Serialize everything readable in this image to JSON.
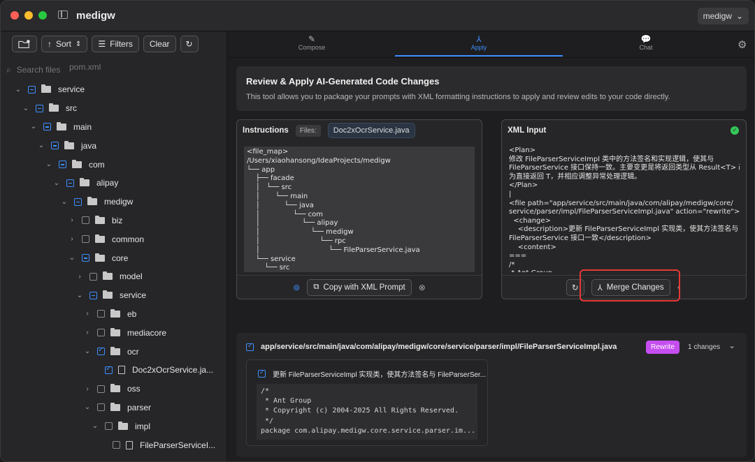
{
  "window": {
    "title": "medigw",
    "project_selector": "medigw"
  },
  "sidebar": {
    "toolbar": {
      "sort_label": "Sort",
      "filters_label": "Filters",
      "clear_label": "Clear"
    },
    "search_placeholder": "Search files",
    "ghost_text": "pom.xml",
    "tree": [
      {
        "label": "service",
        "depth": 1,
        "kind": "folder",
        "check": "ind",
        "open": true
      },
      {
        "label": "src",
        "depth": 2,
        "kind": "folder",
        "check": "ind",
        "open": true
      },
      {
        "label": "main",
        "depth": 3,
        "kind": "folder",
        "check": "ind",
        "open": true
      },
      {
        "label": "java",
        "depth": 4,
        "kind": "folder",
        "check": "ind",
        "open": true
      },
      {
        "label": "com",
        "depth": 5,
        "kind": "folder",
        "check": "ind",
        "open": true
      },
      {
        "label": "alipay",
        "depth": 6,
        "kind": "folder",
        "check": "ind",
        "open": true
      },
      {
        "label": "medigw",
        "depth": 7,
        "kind": "folder",
        "check": "ind",
        "open": true
      },
      {
        "label": "biz",
        "depth": 8,
        "kind": "folder",
        "check": "none",
        "open": false
      },
      {
        "label": "common",
        "depth": 8,
        "kind": "folder",
        "check": "none",
        "open": false
      },
      {
        "label": "core",
        "depth": 8,
        "kind": "folder",
        "check": "ind",
        "open": true
      },
      {
        "label": "model",
        "depth": 9,
        "kind": "folder",
        "check": "none",
        "open": false
      },
      {
        "label": "service",
        "depth": 9,
        "kind": "folder",
        "check": "ind",
        "open": true
      },
      {
        "label": "eb",
        "depth": 10,
        "kind": "folder",
        "check": "none",
        "open": false
      },
      {
        "label": "mediacore",
        "depth": 10,
        "kind": "folder",
        "check": "none",
        "open": false
      },
      {
        "label": "ocr",
        "depth": 10,
        "kind": "folder",
        "check": "chk",
        "open": true
      },
      {
        "label": "Doc2xOcrService.ja...",
        "depth": 11,
        "kind": "file",
        "check": "chk",
        "open": null
      },
      {
        "label": "oss",
        "depth": 10,
        "kind": "folder",
        "check": "none",
        "open": false
      },
      {
        "label": "parser",
        "depth": 10,
        "kind": "folder",
        "check": "none",
        "open": true
      },
      {
        "label": "impl",
        "depth": 11,
        "kind": "folder",
        "check": "none",
        "open": true
      },
      {
        "label": "FileParserServiceI...",
        "depth": 12,
        "kind": "file",
        "check": "none",
        "open": null
      }
    ]
  },
  "tabs": [
    {
      "label": "Compose",
      "icon": "pencil-icon"
    },
    {
      "label": "Apply",
      "icon": "merge-icon"
    },
    {
      "label": "Chat",
      "icon": "chat-bubbles-icon"
    }
  ],
  "review": {
    "title": "Review & Apply AI-Generated Code Changes",
    "description": "This tool allows you to package your prompts with XML formatting instructions to apply and review edits to your code directly."
  },
  "instructions": {
    "title": "Instructions",
    "files_label": "Files:",
    "file_chip": "Doc2xOcrService.java",
    "content": "<file_map>\n/Users/xiaohansong/IdeaProjects/medigw\n└── app\n    ├── facade\n    │   └── src\n    │       └── main\n    │           └── java\n    │               └── com\n    │                   └── alipay\n    │                       └── medigw\n    │                           └── rpc\n    │                               └── FileParserService.java\n    └── service\n        └── src",
    "copy_button": "Copy with XML Prompt"
  },
  "xml_input": {
    "title": "XML Input",
    "content": "<Plan>\n修改 FileParserServiceImpl 类中的方法签名和实现逻辑，使其与\nFileParserService 接口保持一致。主要变更是将返回类型从 Result<T> 改\n为直接返回 T，并相应调整异常处理逻辑。\n</Plan>\n|\n<file path=\"app/service/src/main/java/com/alipay/medigw/core/\nservice/parser/impl/FileParserServiceImpl.java\" action=\"rewrite\">\n  <change>\n    <description>更新 FileParserServiceImpl 实现类，使其方法签名与\nFileParserService 接口一致</description>\n    <content>\n===\n/*\n * Ant Group",
    "merge_button": "Merge Changes"
  },
  "changes": {
    "path": "app/service/src/main/java/com/alipay/medigw/core/service/parser/impl/FileParserServiceImpl.java",
    "badge": "Rewrite",
    "count": "1 changes",
    "change_desc": "更新 FileParserServiceImpl 实现类，使其方法签名与 FileParserSer...",
    "code": "/*\n * Ant Group\n * Copyright (c) 2004-2025 All Rights Reserved.\n */\npackage com.alipay.medigw.core.service.parser.im..."
  },
  "colors": {
    "accent": "#3d8eff",
    "rewrite_badge": "#c54ef0",
    "highlight": "#e53935",
    "ok": "#34c759"
  }
}
